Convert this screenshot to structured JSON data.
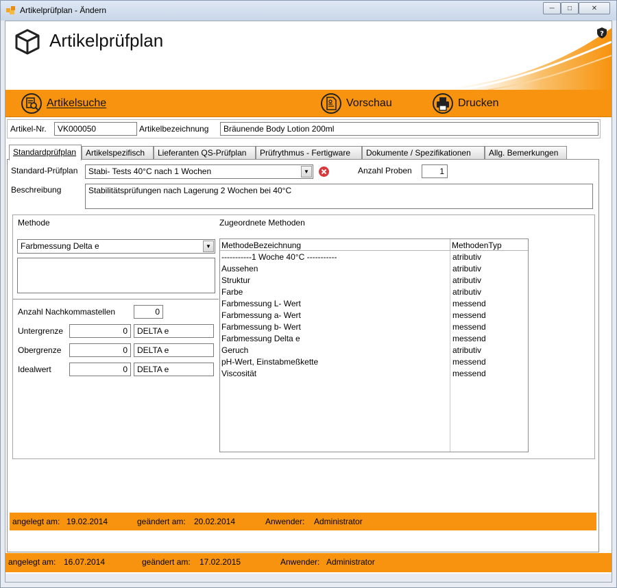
{
  "window": {
    "title": "Artikelprüfplan - Ändern",
    "min_glyph": "─",
    "max_glyph": "□",
    "close_glyph": "✕"
  },
  "header": {
    "title": "Artikelprüfplan"
  },
  "toolbar": {
    "search_label": "Artikelsuche",
    "preview_label": "Vorschau",
    "print_label": "Drucken"
  },
  "article": {
    "nr_label": "Artikel-Nr.",
    "nr_value": "VK000050",
    "name_label": "Artikelbezeichnung",
    "name_value": "Bräunende Body Lotion 200ml"
  },
  "tabs": [
    {
      "label": "Standardprüfplan"
    },
    {
      "label": "Artikelspezifisch"
    },
    {
      "label": "Lieferanten QS-Prüfplan"
    },
    {
      "label": "Prüfrythmus - Fertigware"
    },
    {
      "label": "Dokumente / Spezifikationen"
    },
    {
      "label": "Allg. Bemerkungen"
    }
  ],
  "plan": {
    "label": "Standard-Prüfplan",
    "value": "Stabi- Tests 40°C nach 1 Wochen",
    "samples_label": "Anzahl Proben",
    "samples_value": "1",
    "desc_label": "Beschreibung",
    "desc_value": "Stabilitätsprüfungen nach Lagerung 2 Wochen bei 40°C"
  },
  "method": {
    "label": "Methode",
    "assigned_label": "Zugeordnete Methoden",
    "selected": "Farbmessung Delta e",
    "decimals_label": "Anzahl Nachkommastellen",
    "decimals_value": "0",
    "lower_label": "Untergrenze",
    "lower_value": "0",
    "lower_unit": "DELTA e",
    "upper_label": "Obergrenze",
    "upper_value": "0",
    "upper_unit": "DELTA e",
    "ideal_label": "Idealwert",
    "ideal_value": "0",
    "ideal_unit": "DELTA e"
  },
  "methods_table": {
    "columns": [
      "MethodeBezeichnung",
      "MethodenTyp"
    ],
    "rows": [
      [
        "-----------1 Woche 40°C -----------",
        "atributiv"
      ],
      [
        "Aussehen",
        "atributiv"
      ],
      [
        "Struktur",
        "atributiv"
      ],
      [
        "Farbe",
        "atributiv"
      ],
      [
        "Farbmessung L- Wert",
        "messend"
      ],
      [
        "Farbmessung a- Wert",
        "messend"
      ],
      [
        "Farbmessung b- Wert",
        "messend"
      ],
      [
        "Farbmessung Delta e",
        "messend"
      ],
      [
        "Geruch",
        "atributiv"
      ],
      [
        "pH-Wert, Einstabmeßkette",
        "messend"
      ],
      [
        "Viscosität",
        "messend"
      ]
    ]
  },
  "inner_status": {
    "created_label": "angelegt am:",
    "created_value": "19.02.2014",
    "changed_label": "geändert am:",
    "changed_value": "20.02.2014",
    "user_label": "Anwender:",
    "user_value": "Administrator"
  },
  "outer_status": {
    "created_label": "angelegt am:",
    "created_value": "16.07.2014",
    "changed_label": "geändert am:",
    "changed_value": "17.02.2015",
    "user_label": "Anwender:",
    "user_value": "Administrator"
  },
  "colors": {
    "accent": "#f7930e",
    "clear_icon": "#d9373a"
  }
}
